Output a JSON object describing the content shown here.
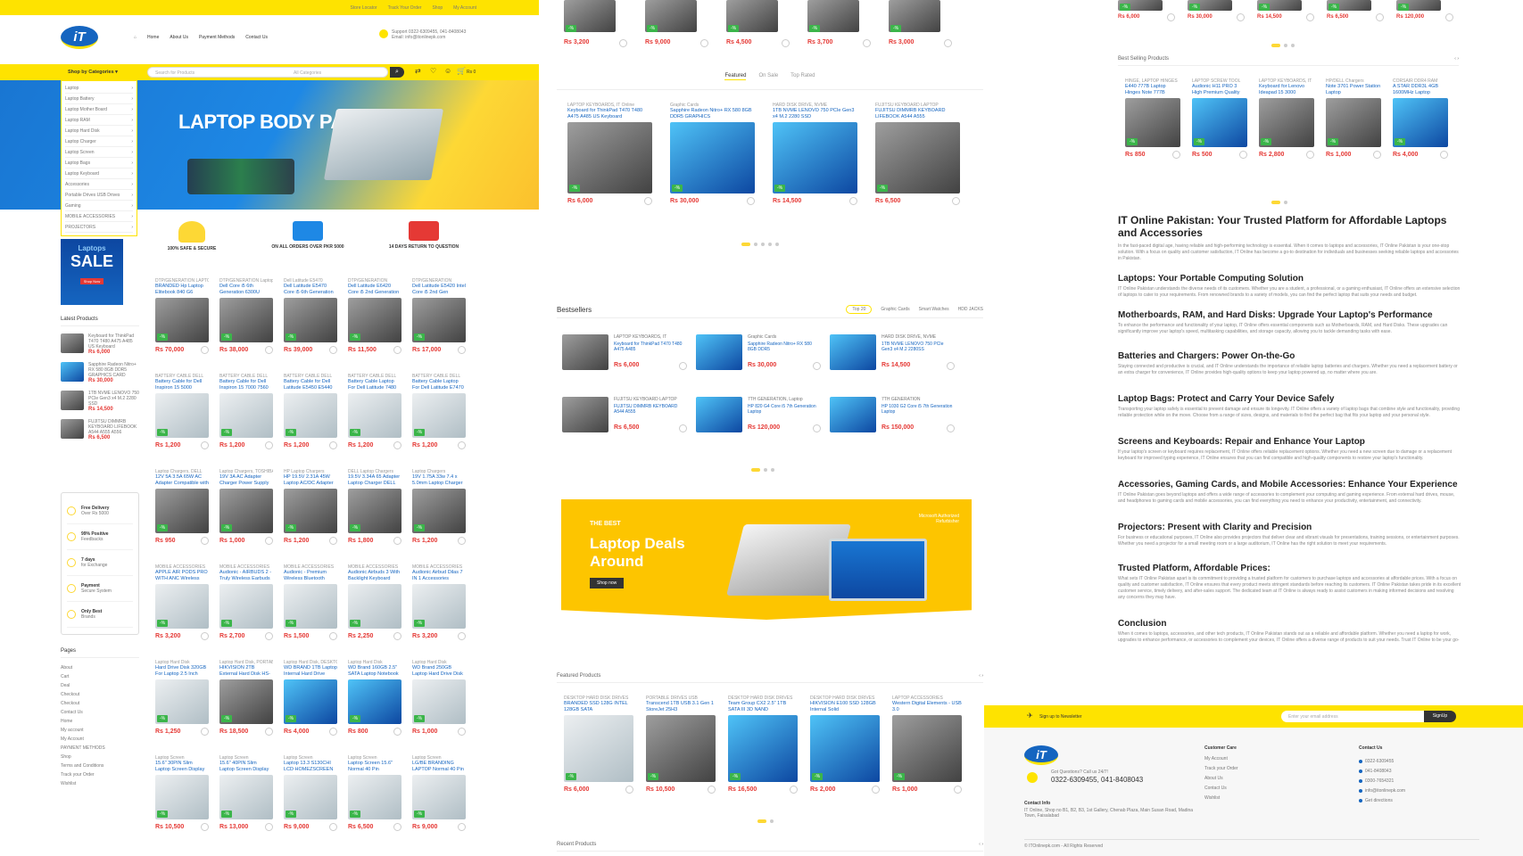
{
  "topbar": {
    "links": [
      "Store Locator",
      "Track Your Order",
      "Shop",
      "My Account"
    ]
  },
  "header": {
    "logo": "iT",
    "nav": [
      "Home",
      "About Us",
      "Payment Methods",
      "Contact Us"
    ],
    "support_label": "Support",
    "support_phone": "0322-6309455, 041-8408043",
    "support_email": "Email: info@itonlinepk.com"
  },
  "searchbar": {
    "categories_label": "Shop by Categories",
    "placeholder": "Search for Products",
    "all_categories": "All Categories",
    "cart_count": "0",
    "cart_total": "Rs 0"
  },
  "sidebar_categories": [
    "Laptop",
    "Laptop Battery",
    "Laptop Mother Board",
    "Laptop RAM",
    "Laptop Hard Disk",
    "Laptop Charger",
    "Laptop Screen",
    "Laptop Bags",
    "Laptop Keyboard",
    "Accessories",
    "Portable Drives USB Drives",
    "Gaming",
    "MOBILE ACCESSORIES",
    "PROJECTORS"
  ],
  "hero": {
    "title": "LAPTOP BODY PARTS"
  },
  "promo_icons": [
    {
      "label": "100% SAFE & SECURE"
    },
    {
      "label": "ON ALL ORDERS OVER PKR 5000"
    },
    {
      "label": "14 DAYS RETURN TO QUESTION"
    }
  ],
  "sale_banner": {
    "line1": "Laptops",
    "line2": "SALE",
    "cta": "Shop Now"
  },
  "latest": {
    "title": "Latest Products",
    "items": [
      {
        "name": "Keyboard for ThinkPad T470 T480 A475 A485 US Keyboard",
        "price": "Rs 6,000"
      },
      {
        "name": "Sapphire Radeon Nitro+ RX 580 8GB DDR5 GRAPHICS CARD",
        "price": "Rs 30,000"
      },
      {
        "name": "1TB NVME LENOVO 750 PCIe Gen3 x4 M.2 2280 SSD",
        "price": "Rs 14,500"
      },
      {
        "name": "FUJITSU DIMMRB KEYBOARD LIFEBOOK A544 A555 A556",
        "price": "Rs 6,500"
      }
    ]
  },
  "features": [
    {
      "title": "Free Delivery",
      "sub": "Over Rs 5000"
    },
    {
      "title": "99% Positive",
      "sub": "Feedbacks"
    },
    {
      "title": "7 days",
      "sub": "for Exchange"
    },
    {
      "title": "Payment",
      "sub": "Secure System"
    },
    {
      "title": "Only Best",
      "sub": "Brands"
    }
  ],
  "pages": {
    "title": "Pages",
    "items": [
      "About",
      "Cart",
      "Deal",
      "Checkout",
      "Checkout",
      "Contact Us",
      "Home",
      "My account",
      "My Account",
      "PAYMENT METHODS",
      "Shop",
      "Terms and Conditions",
      "Track your Order",
      "Wishlist"
    ]
  },
  "grid_c1": [
    [
      {
        "cat": "DTP/GENERATION LAPTOP",
        "nm": "BRANDED Hp Laptop Elitebook 840 G6 Laptop",
        "price": "Rs 70,000",
        "t": "k"
      },
      {
        "cat": "DTP/GENERATION Laptop",
        "nm": "Dell Core i5 6th Generation 6300U",
        "price": "Rs 38,000",
        "t": "k"
      },
      {
        "cat": "Dell Latitude E5470",
        "nm": "Dell Latitude E5470 Core i5 6th Generation Laptop",
        "price": "Rs 39,000",
        "t": "k"
      },
      {
        "cat": "DTP/GENERATION",
        "nm": "Dell Latitude E6420 Core i5 2nd Generation",
        "price": "Rs 11,500",
        "t": "k"
      },
      {
        "cat": "DTP/GENERATION",
        "nm": "Dell Latitude E5420 Intel Core i5 2nd Gen",
        "price": "Rs 17,000",
        "t": "k"
      }
    ],
    [
      {
        "cat": "BATTERY CABLE DELL",
        "nm": "Battery Cable for Dell Inspiron 15 5000",
        "price": "Rs 1,200",
        "t": "l"
      },
      {
        "cat": "BATTERY CABLE DELL",
        "nm": "Battery Cable for Dell Inspiron 15 7000 7560",
        "price": "Rs 1,200",
        "t": "l"
      },
      {
        "cat": "BATTERY CABLE DELL",
        "nm": "Battery Cable for Dell Latitude E5450 E5440",
        "price": "Rs 1,200",
        "t": "l"
      },
      {
        "cat": "BATTERY CABLE DELL",
        "nm": "Battery Cable Laptop For Dell Latitude 7480 7490",
        "price": "Rs 1,200",
        "t": "l"
      },
      {
        "cat": "BATTERY CABLE DELL",
        "nm": "Battery Cable Laptop For Dell Latitude E7470",
        "price": "Rs 1,200",
        "t": "l"
      }
    ],
    [
      {
        "cat": "Laptop Chargers, DELL",
        "nm": "12V 5A 3.5A 65W AC Adapter Compatible with",
        "price": "Rs 950",
        "t": "k"
      },
      {
        "cat": "Laptop Chargers, TOSHIBA",
        "nm": "19V 3A AC Adapter Charger Power Supply",
        "price": "Rs 1,000",
        "t": "k"
      },
      {
        "cat": "HP Laptop Chargers",
        "nm": "HP 19.5V 2.31A 45W Laptop AC/DC Adapter",
        "price": "Rs 1,200",
        "t": "k"
      },
      {
        "cat": "DELL Laptop Chargers",
        "nm": "19.5V 3.34A 65 Adapter Laptop Charger DELL",
        "price": "Rs 1,800",
        "t": "k"
      },
      {
        "cat": "Laptop Chargers",
        "nm": "19V 1.75A 33w 7.4 x 5.0mm Laptop Charger",
        "price": "Rs 1,200",
        "t": "k"
      }
    ],
    [
      {
        "cat": "MOBILE ACCESSORIES",
        "nm": "APPLE AIR PODS PRO WITH ANC Wireless",
        "price": "Rs 3,200",
        "t": "l"
      },
      {
        "cat": "MOBILE ACCESSORIES",
        "nm": "Audionic - AIRBUDS 2 - Truly Wireless Earbuds",
        "price": "Rs 2,700",
        "t": "l"
      },
      {
        "cat": "MOBILE ACCESSORIES",
        "nm": "Audionic - Premium Wireless Bluetooth",
        "price": "Rs 1,500",
        "t": "l"
      },
      {
        "cat": "MOBILE ACCESSORIES",
        "nm": "Audionic Airbuds 3 With Backlight Keyboard",
        "price": "Rs 2,250",
        "t": "l"
      },
      {
        "cat": "MOBILE ACCESSORIES",
        "nm": "Audionic Airbud Dilas 7 IN 1 Accessories",
        "price": "Rs 3,200",
        "t": "l"
      }
    ],
    [
      {
        "cat": "Laptop Hard Disk",
        "nm": "Hard Drive Disk 320GB For Laptop 2.5 Inch",
        "price": "Rs 1,250",
        "t": "l"
      },
      {
        "cat": "Laptop Hard Disk, PORTABLE",
        "nm": "HIKVISION 2TB External Hard Disk HS-EHDD-T30",
        "price": "Rs 18,500",
        "t": "k"
      },
      {
        "cat": "Laptop Hard Disk, DESKTOP",
        "nm": "WD BRAND 1TB Laptop Internal Hard Drive",
        "price": "Rs 4,000",
        "t": "b"
      },
      {
        "cat": "Laptop Hard Disk",
        "nm": "WD Brand 160GB 2.5\" SATA Laptop Notebook",
        "price": "Rs 800",
        "t": "b"
      },
      {
        "cat": "Laptop Hard Disk",
        "nm": "WD Brand 250GB Laptop Hard Drive Disk",
        "price": "Rs 1,000",
        "t": "l"
      }
    ],
    [
      {
        "cat": "Laptop Screen",
        "nm": "15.6\" 30PIN Slim Laptop Screen Display",
        "price": "Rs 10,500",
        "t": "l"
      },
      {
        "cat": "Laptop Screen",
        "nm": "15.6\" 40PIN Slim Laptop Screen Display Screen",
        "price": "Rs 13,000",
        "t": "l"
      },
      {
        "cat": "Laptop Screen",
        "nm": "Laptop 13.3 S130CHI LCD HOMEZSCREEN",
        "price": "Rs 9,000",
        "t": "l"
      },
      {
        "cat": "Laptop Screen",
        "nm": "Laptop Screen 15.6\" Normal 40 Pin",
        "price": "Rs 6,500",
        "t": "l"
      },
      {
        "cat": "Laptop Screen",
        "nm": "LG/BE BRANDING LAPTOP Normal 40 Pin 15.6\"",
        "price": "Rs 9,000",
        "t": "l"
      }
    ]
  ],
  "c2_top_prices": [
    "Rs 3,200",
    "Rs 9,000",
    "Rs 4,500",
    "Rs 3,700",
    "Rs 3,000"
  ],
  "tabs1": [
    "Featured",
    "On Sale",
    "Top Rated"
  ],
  "featured_row": [
    {
      "cat": "LAPTOP KEYBOARDS, IT Online",
      "nm": "Keyboard for ThinkPad T470 T480 A475 A485 US Keyboard",
      "price": "Rs 6,000",
      "t": "k"
    },
    {
      "cat": "Graphic Cards",
      "nm": "Sapphire Radeon Nitro+ RX 580 8GB DDR5 GRAPHICS",
      "price": "Rs 30,000",
      "t": "b"
    },
    {
      "cat": "HARD DISK DRIVE, NVME",
      "nm": "1TB NVME LENOVO 750 PCIe Gen3 x4 M.2 2280 SSD",
      "price": "Rs 14,500",
      "t": "b"
    },
    {
      "cat": "FUJITSU KEYBOARD LAPTOP",
      "nm": "FUJITSU DIMMRB KEYBOARD LIFEBOOK A544 A555",
      "price": "Rs 6,500",
      "t": "k"
    }
  ],
  "bestsellers": {
    "title": "Bestsellers",
    "tabs": [
      "Top 20",
      "Graphic Cards",
      "Smart Watches",
      "HDD JACKS"
    ],
    "items": [
      {
        "cat": "LAPTOP KEYBOARDS, IT",
        "nm": "Keyboard for ThinkPad T470 T480 A475 A485",
        "price": "Rs 6,000",
        "t": "k"
      },
      {
        "cat": "Graphic Cards",
        "nm": "Sapphire Radeon Nitro+ RX 580 8GB DDR5",
        "price": "Rs 30,000",
        "t": "b"
      },
      {
        "cat": "HARD DISK DRIVE, NVME",
        "nm": "1TB NVME LENOVO 750 PCIe Gen3 x4 M.2 2280SS",
        "price": "Rs 14,500",
        "t": "b"
      },
      {
        "cat": "FUJITSU KEYBOARD LAPTOP",
        "nm": "FUJITSU DIMMRB KEYBOARD A544 A555",
        "price": "Rs 6,500",
        "t": "k"
      },
      {
        "cat": "7TH GENERATION, Laptop",
        "nm": "HP 820 G4 Core i5 7th Generation Laptop",
        "price": "Rs 120,000",
        "t": "b"
      },
      {
        "cat": "7TH GENERATION",
        "nm": "HP 1030 G2 Core i5 7th Generation Laptop",
        "price": "Rs 150,000",
        "t": "b"
      }
    ]
  },
  "deal_banner": {
    "kicker": "THE BEST",
    "title1": "Laptop Deals",
    "title2": "Around",
    "cta": "Shop now",
    "brand": "Microsoft Authorized Refurbisher"
  },
  "featured_products": {
    "title": "Featured Products",
    "items": [
      {
        "cat": "DESKTOP HARD DISK DRIVES",
        "nm": "BRANDED SSD 128G INTEL 128GB SATA",
        "price": "Rs 6,000",
        "t": "l"
      },
      {
        "cat": "PORTABLE DRIVES USB",
        "nm": "Transcend 1TB USB 3.1 Gen 1 StoreJet 25H3",
        "price": "Rs 10,500",
        "t": "k"
      },
      {
        "cat": "DESKTOP HARD DISK DRIVES",
        "nm": "Team Group CX2 2.5\" 1TB SATA III 3D NAND",
        "price": "Rs 16,500",
        "t": "b"
      },
      {
        "cat": "DESKTOP HARD DISK DRIVES",
        "nm": "HIKVISION E100 SSD 128GB Internal Solid",
        "price": "Rs 2,000",
        "t": "b"
      },
      {
        "cat": "LAPTOP ACCESSORIES",
        "nm": "Western Digital Elements - USB 3.0",
        "price": "Rs 1,000",
        "t": "k"
      }
    ]
  },
  "recent_products": {
    "title": "Recent Products"
  },
  "c3_top_prices": [
    "Rs 6,000",
    "Rs 30,000",
    "Rs 14,500",
    "Rs 6,500",
    "Rs 120,000"
  ],
  "best_selling": {
    "title": "Best Selling Products",
    "items": [
      {
        "cat": "HINGE, LAPTOP HINGES",
        "nm": "E440 777B Laptop Hinges Note 777B",
        "price": "Rs 850",
        "t": "k"
      },
      {
        "cat": "LAPTOP SCREW TOOL",
        "nm": "Audionic H11 PRO 3 High Premium Quality",
        "price": "Rs 500",
        "t": "b"
      },
      {
        "cat": "LAPTOP KEYBOARDS, IT",
        "nm": "Keyboard for Lenovo Ideapad 15 3000",
        "price": "Rs 2,800",
        "t": "k"
      },
      {
        "cat": "HP/DELL Chargers",
        "nm": "Note 3701 Power Station Laptop",
        "price": "Rs 1,000",
        "t": "k"
      },
      {
        "cat": "CORSAIR DDR4 RAM",
        "nm": "A STAR DDR3L 4GB 1600MHz Laptop",
        "price": "Rs 4,000",
        "t": "b"
      }
    ]
  },
  "article": {
    "title": "IT Online Pakistan: Your Trusted Platform for Affordable Laptops and Accessories",
    "intro": "In the fast-paced digital age, having reliable and high-performing technology is essential. When it comes to laptops and accessories, IT Online Pakistan is your one-stop solution. With a focus on quality and customer satisfaction, IT Online has become a go-to destination for individuals and businesses seeking reliable laptops and accessories in Pakistan.",
    "sections": [
      {
        "h": "Laptops: Your Portable Computing Solution",
        "p": "IT Online Pakistan understands the diverse needs of its customers. Whether you are a student, a professional, or a gaming enthusiast, IT Online offers an extensive selection of laptops to cater to your requirements. From renowned brands to a variety of models, you can find the perfect laptop that suits your needs and budget."
      },
      {
        "h": "Motherboards, RAM, and Hard Disks: Upgrade Your Laptop's Performance",
        "p": "To enhance the performance and functionality of your laptop, IT Online offers essential components such as Motherboards, RAM, and Hard Disks. These upgrades can significantly improve your laptop's speed, multitasking capabilities, and storage capacity, allowing you to tackle demanding tasks with ease."
      },
      {
        "h": "Batteries and Chargers: Power On-the-Go",
        "p": "Staying connected and productive is crucial, and IT Online understands the importance of reliable laptop batteries and chargers. Whether you need a replacement battery or an extra charger for convenience, IT Online provides high-quality options to keep your laptop powered up, no matter where you are."
      },
      {
        "h": "Laptop Bags: Protect and Carry Your Device Safely",
        "p": "Transporting your laptop safely is essential to prevent damage and ensure its longevity. IT Online offers a variety of laptop bags that combine style and functionality, providing reliable protection while on the move. Choose from a range of sizes, designs, and materials to find the perfect bag that fits your laptop and your personal style."
      },
      {
        "h": "Screens and Keyboards: Repair and Enhance Your Laptop",
        "p": "If your laptop's screen or keyboard requires replacement, IT Online offers reliable replacement options. Whether you need a new screen due to damage or a replacement keyboard for improved typing experience, IT Online ensures that you can find compatible and high-quality components to restore your laptop's functionality."
      },
      {
        "h": "Accessories, Gaming Cards, and Mobile Accessories: Enhance Your Experience",
        "p": "IT Online Pakistan goes beyond laptops and offers a wide range of accessories to complement your computing and gaming experience. From external hard drives, mouse, and headphones to gaming cards and mobile accessories, you can find everything you need to enhance your productivity, entertainment, and connectivity."
      },
      {
        "h": "Projectors: Present with Clarity and Precision",
        "p": "For business or educational purposes, IT Online also provides projectors that deliver clear and vibrant visuals for presentations, training sessions, or entertainment purposes. Whether you need a projector for a small meeting room or a large auditorium, IT Online has the right solution to meet your requirements."
      },
      {
        "h": "Trusted Platform, Affordable Prices:",
        "p": "What sets IT Online Pakistan apart is its commitment to providing a trusted platform for customers to purchase laptops and accessories at affordable prices. With a focus on quality and customer satisfaction, IT Online ensures that every product meets stringent standards before reaching its customers. IT Online Pakistan takes pride in its excellent customer service, timely delivery, and after-sales support. The dedicated team at IT Online is always ready to assist customers in making informed decisions and resolving any concerns they may have."
      },
      {
        "h": "Conclusion",
        "p": "When it comes to laptops, accessories, and other tech products, IT Online Pakistan stands out as a reliable and affordable platform. Whether you need a laptop for work, upgrades to enhance performance, or accessories to complement your devices, IT Online offers a diverse range of products to suit your needs. Trust IT Online to be your go-to destination for quality, affordability, and exceptional customer service in the world of laptops and accessories in Pakistan."
      }
    ]
  },
  "newsletter": {
    "label": "Sign up to Newsletter",
    "placeholder": "Enter your email address",
    "button": "SignUp"
  },
  "footer": {
    "contact_prefix": "Got Questions? Call us 24/7!",
    "phone": "0322-6309455, 041-8408043",
    "contact_info_label": "Contact Info",
    "contact_info": "IT Online, Shop no B1, B2, B3, 1st Gallery, Chenab Plaza, Main Susan Road, Madina Town, Faisalabad",
    "customer_care_title": "Customer Care",
    "customer_care": [
      "My Account",
      "Track your Order",
      "About Us",
      "Contact Us",
      "Wishlist"
    ],
    "contact_title": "Contact Us",
    "contact": [
      "0322-6309455",
      "041-8408043",
      "0300-7654321",
      "info@itonlinepk.com",
      "Get directions"
    ],
    "copyright": "© ITOnlinepk.com - All Rights Reserved"
  },
  "colors": {
    "yellow": "#fee300",
    "blue": "#1565c0",
    "red": "#e53935",
    "green": "#3bb54a"
  }
}
